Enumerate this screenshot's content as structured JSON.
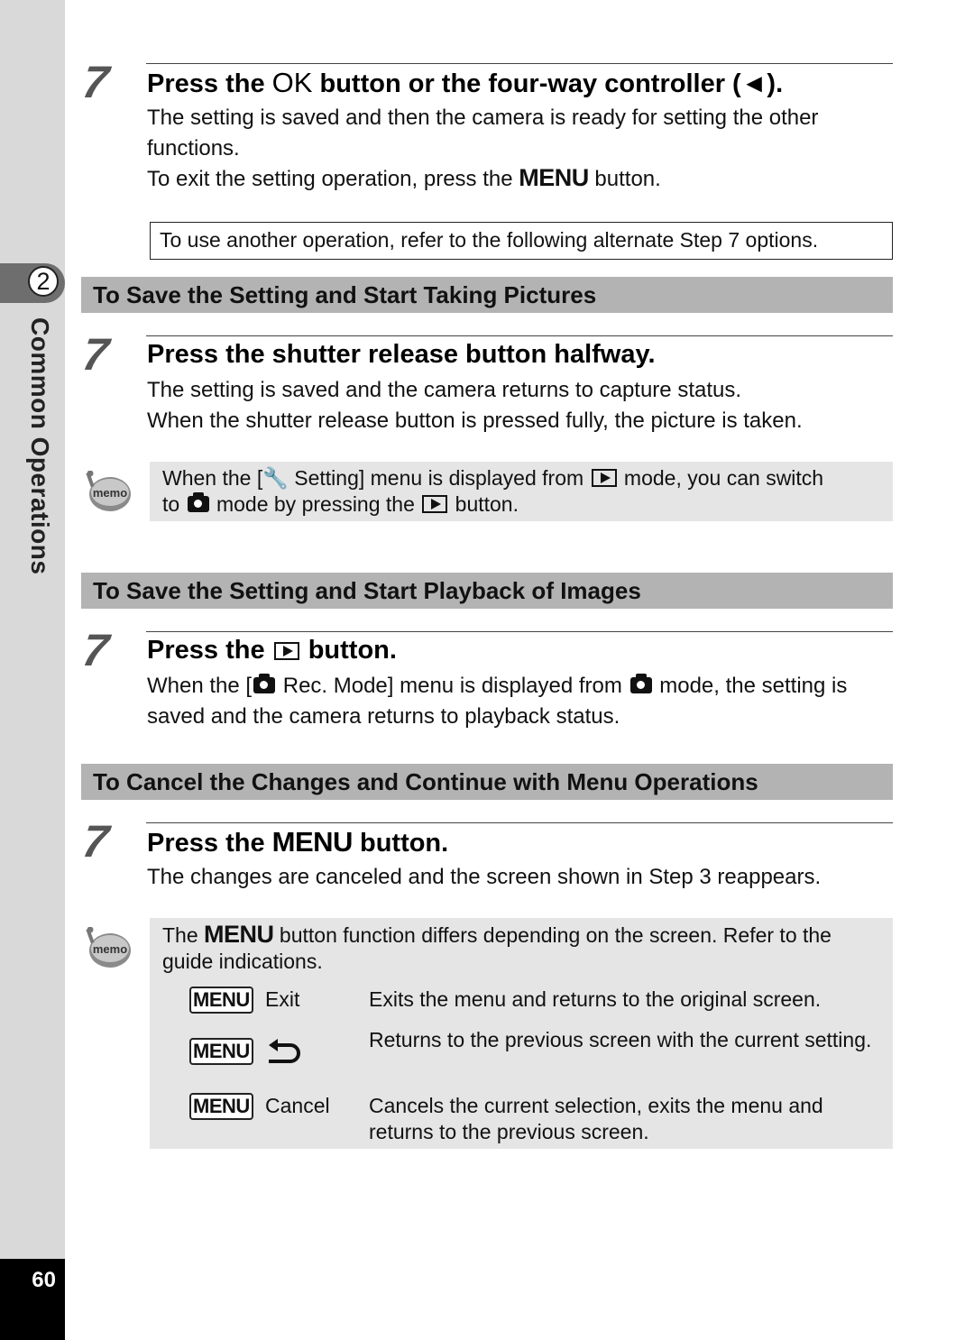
{
  "sidebar": {
    "chapter_number": "2",
    "chapter_title": "Common Operations",
    "page_number": "60"
  },
  "steps": [
    {
      "number": "7",
      "title_parts": [
        "Press the ",
        "OK",
        " button or the four-way controller (",
        "◄",
        ")."
      ],
      "body": [
        "The setting is saved and then the camera is ready for setting the other functions.",
        [
          "To exit the setting operation, press the ",
          "MENU",
          " button."
        ]
      ]
    },
    {
      "number": "7",
      "title": "Press the shutter release button halfway.",
      "body": [
        "The setting is saved and the camera returns to capture status.",
        "When the shutter release button is pressed fully, the picture is taken."
      ]
    },
    {
      "number": "7",
      "title_parts": [
        "Press the ",
        "button."
      ],
      "body_parts": [
        "When the [",
        " Rec. Mode] menu is displayed from ",
        " mode, the setting is saved and the camera returns to playback status."
      ]
    },
    {
      "number": "7",
      "title_parts": [
        "Press the ",
        "MENU",
        " button."
      ],
      "body": [
        "The changes are canceled and the screen shown in Step 3 reappears."
      ]
    }
  ],
  "notice": "To use another operation, refer to the following alternate Step 7 options.",
  "sections": [
    "To Save the Setting and Start Taking Pictures",
    "To Save the Setting and Start Playback of Images",
    "To Cancel the Changes and Continue with Menu Operations"
  ],
  "memo1": {
    "icon": "memo-icon",
    "parts": [
      "When the [",
      " Setting] menu is displayed from ",
      " mode, you can switch",
      "to ",
      " mode by pressing the ",
      " button."
    ]
  },
  "memo2": {
    "icon": "memo-icon",
    "intro_parts": [
      "The ",
      "MENU",
      " button function differs depending on the screen. Refer to the guide indications."
    ],
    "guide": [
      {
        "key": "MENU",
        "label": "Exit",
        "desc": "Exits the menu and returns to the original screen."
      },
      {
        "key": "MENU",
        "label": "",
        "label_icon": "return-arrow-icon",
        "desc": "Returns to the previous screen with the current setting."
      },
      {
        "key": "MENU",
        "label": "Cancel",
        "desc": "Cancels the current selection, exits the menu and returns to the previous screen."
      }
    ]
  }
}
